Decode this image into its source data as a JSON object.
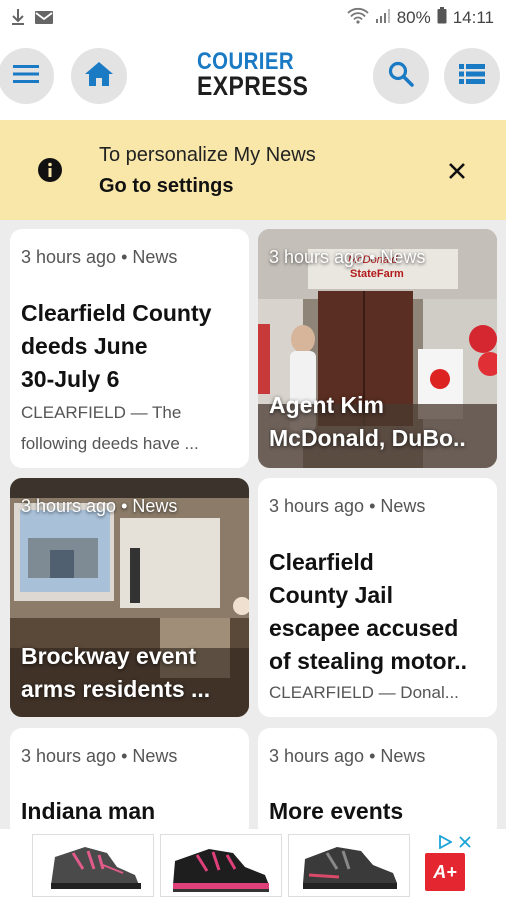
{
  "status_bar": {
    "battery": "80%",
    "time": "14:11"
  },
  "header": {
    "logo_line1": "COURIER",
    "logo_line2": "EXPRESS"
  },
  "notice": {
    "text": "To personalize My News",
    "link": "Go to settings"
  },
  "cards": [
    {
      "meta": "3 hours ago • News",
      "title_lines": [
        "Clearfield County",
        "deeds June",
        "30-July 6"
      ],
      "summary_lines": [
        "CLEARFIELD — The",
        "following deeds have ..."
      ]
    },
    {
      "meta": "3 hours ago • News",
      "title_lines": [
        "Agent Kim",
        "McDonald, DuBo.."
      ]
    },
    {
      "meta": "3 hours ago • News",
      "title_lines": [
        "Brockway event",
        "arms residents ..."
      ]
    },
    {
      "meta": "3 hours ago • News",
      "title_lines": [
        "Clearfield",
        "County Jail",
        "escapee accused",
        "of stealing motor.."
      ],
      "summary_lines": [
        "CLEARFIELD — Donal..."
      ]
    },
    {
      "meta": "3 hours ago • News",
      "title_lines": [
        "Indiana man"
      ]
    },
    {
      "meta": "3 hours ago • News",
      "title_lines": [
        "More events"
      ]
    }
  ],
  "photo_signs": {
    "sign1": "McDonald",
    "sign2": "StateFarm"
  },
  "ad": {
    "brand_icon": "A+",
    "icons": [
      "ad-choices-icon",
      "ad-close-icon"
    ]
  }
}
